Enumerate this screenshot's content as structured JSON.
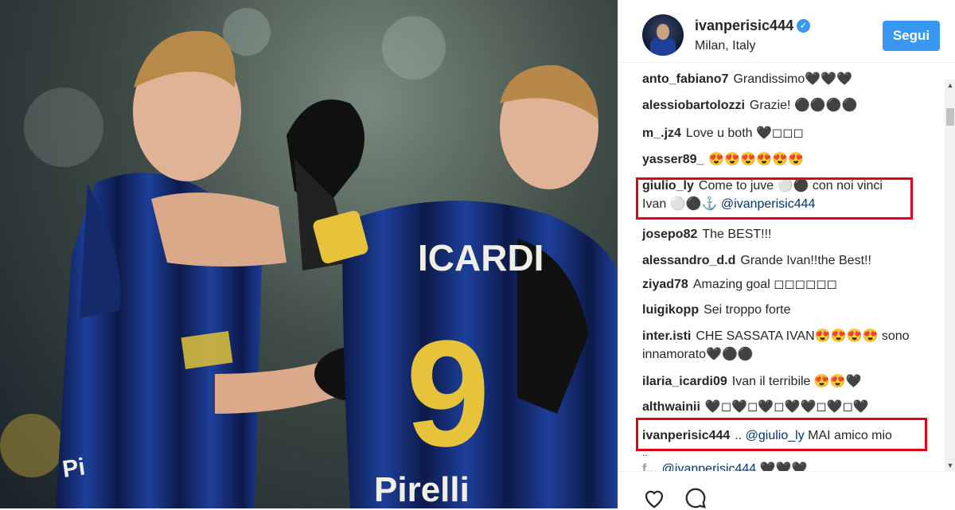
{
  "post": {
    "username": "ivanperisic444",
    "location": "Milan, Italy",
    "follow_label": "Segui",
    "verified_glyph": "✓"
  },
  "photo": {
    "jersey_name": "ICARDI",
    "jersey_number": "9",
    "sponsor_text": "Pirelli"
  },
  "comments": [
    {
      "user": "anto_fabiano7",
      "text": "Grandissimo🖤🖤🖤"
    },
    {
      "user": "alessiobartolozzi",
      "text": "Grazie! ⚫⚫⚫⚫"
    },
    {
      "user": "m_.jz4",
      "text": "Love u both 🖤◻◻◻"
    },
    {
      "user": "yasser89_",
      "text": "😍😍😍😍😍😍"
    },
    {
      "user": "giulio_ly",
      "text": "Come to juve ⚪⚫ con noi vinci Ivan ⚪⚫⚓ ",
      "mention": "@ivanperisic444"
    },
    {
      "user": "josepo82",
      "text": "The BEST!!!"
    },
    {
      "user": "alessandro_d.d",
      "text": "Grande Ivan!!the Best!!"
    },
    {
      "user": "ziyad78",
      "text": "Amazing goal ◻◻◻◻◻◻"
    },
    {
      "user": "luigikopp",
      "text": "Sei troppo forte"
    },
    {
      "user": "inter.isti",
      "text": "CHE SASSATA IVAN😍😍😍😍 sono innamorato🖤⚫⚫"
    },
    {
      "user": "ilaria_icardi09",
      "text": "Ivan il terribile 😍😍🖤"
    },
    {
      "user": "althwainii",
      "text": "🖤◻🖤◻🖤◻🖤🖤◻🖤◻🖤"
    },
    {
      "user": "ivanperisic444",
      "text": ".. ",
      "mention": "@giulio_ly",
      "text2": " MAI amico mio"
    },
    {
      "user": "",
      "text": ".."
    },
    {
      "user": "f...",
      "text": "",
      "mention": "@ivanperisic444",
      "text2": " 🖤🖤🖤"
    }
  ],
  "colors": {
    "accent": "#3897f0",
    "highlight_border": "#e0001b",
    "mention": "#003569",
    "inter_blue": "#1d3f9a"
  },
  "icons": [
    "heart-icon",
    "comment-icon",
    "verified-icon"
  ]
}
